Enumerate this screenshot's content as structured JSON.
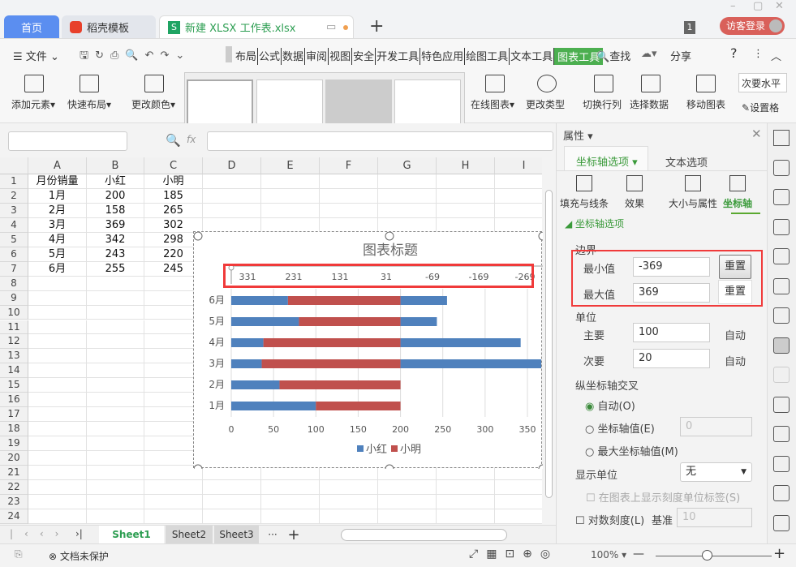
{
  "tabs": {
    "home": "首页",
    "template": "稻壳模板",
    "file": "新建 XLSX 工作表.xlsx",
    "count": "1",
    "login": "访客登录"
  },
  "menu": {
    "file": "文件",
    "items": [
      "布局",
      "公式",
      "数据",
      "审阅",
      "视图",
      "安全",
      "开发工具",
      "特色应用",
      "绘图工具",
      "文本工具",
      "图表工具"
    ],
    "find": "查找",
    "share": "分享",
    "help": "?"
  },
  "ribbon": {
    "add_element": "添加元素",
    "quick_layout": "快速布局",
    "change_color": "更改颜色",
    "online_chart": "在线图表",
    "change_type": "更改类型",
    "switch_row_col": "切换行列",
    "select_data": "选择数据",
    "move_chart": "移动图表",
    "secondary_h": "次要水平",
    "set_format": "设置格"
  },
  "formula": {
    "namebox": "",
    "fx": "fx",
    "value": ""
  },
  "columns": [
    "A",
    "B",
    "C",
    "D",
    "E",
    "F",
    "G",
    "H",
    "I"
  ],
  "rows": [
    "1",
    "2",
    "3",
    "4",
    "5",
    "6",
    "7",
    "8",
    "9",
    "10",
    "11",
    "12",
    "13",
    "14",
    "15",
    "16",
    "17",
    "18",
    "19",
    "20",
    "21",
    "22",
    "23",
    "24"
  ],
  "table": [
    [
      "月份销量",
      "小红",
      "小明"
    ],
    [
      "1月",
      "200",
      "185"
    ],
    [
      "2月",
      "158",
      "265"
    ],
    [
      "3月",
      "369",
      "302"
    ],
    [
      "4月",
      "342",
      "298"
    ],
    [
      "5月",
      "243",
      "220"
    ],
    [
      "6月",
      "255",
      "245"
    ]
  ],
  "chart_data": {
    "type": "bar",
    "title": "图表标题",
    "categories": [
      "1月",
      "2月",
      "3月",
      "4月",
      "5月",
      "6月"
    ],
    "series": [
      {
        "name": "小红",
        "color": "#4f81bd",
        "values": [
          200,
          158,
          369,
          342,
          243,
          255
        ]
      },
      {
        "name": "小明",
        "color": "#c0504d",
        "values": [
          185,
          265,
          302,
          298,
          220,
          245
        ]
      }
    ],
    "segments": [
      [
        {
          "s": "小红",
          "from": 0,
          "to": 100
        },
        {
          "s": "小明",
          "from": 100,
          "to": 200
        }
      ],
      [
        {
          "s": "小红",
          "from": 0,
          "to": 57
        },
        {
          "s": "小明",
          "from": 57,
          "to": 200
        }
      ],
      [
        {
          "s": "小红",
          "from": 0,
          "to": 36
        },
        {
          "s": "小明",
          "from": 36,
          "to": 200
        },
        {
          "s": "小红",
          "from": 200,
          "to": 369
        }
      ],
      [
        {
          "s": "小红",
          "from": 0,
          "to": 38
        },
        {
          "s": "小明",
          "from": 38,
          "to": 200
        },
        {
          "s": "小红",
          "from": 200,
          "to": 342
        }
      ],
      [
        {
          "s": "小红",
          "from": 0,
          "to": 80
        },
        {
          "s": "小明",
          "from": 80,
          "to": 200
        },
        {
          "s": "小红",
          "from": 200,
          "to": 243
        }
      ],
      [
        {
          "s": "小红",
          "from": 0,
          "to": 67
        },
        {
          "s": "小明",
          "from": 67,
          "to": 200
        },
        {
          "s": "小红",
          "from": 200,
          "to": 255
        }
      ]
    ],
    "x_ticks": [
      "0",
      "50",
      "100",
      "150",
      "200",
      "250",
      "300",
      "350"
    ],
    "xlim": [
      0,
      350
    ],
    "top_axis_ticks": [
      "331",
      "231",
      "131",
      "31",
      "-69",
      "-169",
      "-269"
    ],
    "legend": [
      "小红",
      "小明"
    ],
    "legend_position": "bottom",
    "grid": true
  },
  "panel": {
    "title": "属性",
    "tab_axis": "坐标轴选项",
    "tab_text": "文本选项",
    "sub": [
      "填充与线条",
      "效果",
      "大小与属性",
      "坐标轴"
    ],
    "section": "坐标轴选项",
    "bounds": "边界",
    "min_label": "最小值",
    "min_value": "-369",
    "max_label": "最大值",
    "max_value": "369",
    "reset": "重置",
    "units": "单位",
    "major_label": "主要",
    "major_value": "100",
    "minor_label": "次要",
    "minor_value": "20",
    "auto": "自动",
    "cross": "纵坐标轴交叉",
    "cross_auto": "自动(O)",
    "cross_value": "坐标轴值(E)",
    "cross_value_input": "0",
    "cross_max": "最大坐标轴值(M)",
    "display_unit": "显示单位",
    "display_unit_value": "无",
    "show_unit_label": "在图表上显示刻度单位标签(S)",
    "log": "对数刻度(L)",
    "base": "基准",
    "base_value": "10"
  },
  "sheets": [
    "Sheet1",
    "Sheet2",
    "Sheet3"
  ],
  "status": {
    "protect": "文档未保护",
    "zoom": "100%"
  }
}
